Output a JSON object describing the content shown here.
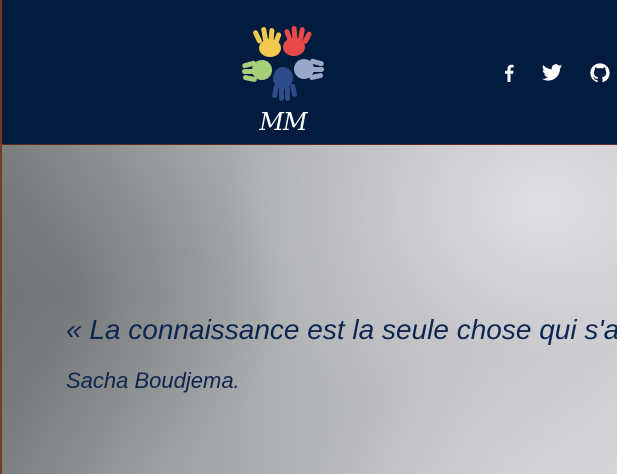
{
  "header": {
    "logo_text": "MM",
    "colors": {
      "background": "#021b3e",
      "hand_colors": [
        "#f2c94c",
        "#e84a4a",
        "#9aa8c9",
        "#2f4b8a",
        "#a8d07a"
      ]
    }
  },
  "social": {
    "items": [
      {
        "name": "facebook",
        "icon": "facebook-icon"
      },
      {
        "name": "twitter",
        "icon": "twitter-icon"
      },
      {
        "name": "github",
        "icon": "github-icon"
      }
    ]
  },
  "hero": {
    "quote": "« La connaissance est la seule chose qui s'accroît lorsqu'on la partage",
    "author": "Sacha Boudjema.",
    "text_color": "#0d2650"
  }
}
